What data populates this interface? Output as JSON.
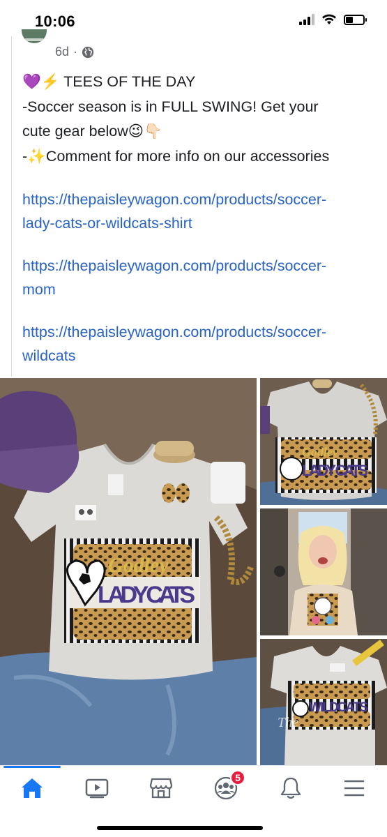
{
  "status_bar": {
    "time": "10:06",
    "battery_level": 0.4,
    "signal_bars": 3
  },
  "post": {
    "age": "6d",
    "separator": "·",
    "audience_icon": "globe-icon",
    "lines": [
      "💜⚡️ TEES OF THE DAY",
      "-Soccer season is in FULL SWING! Get your",
      "cute gear below😉👇🏻",
      "-✨Comment for more info on our accessories"
    ],
    "links": [
      {
        "line1": "https://thepaisleywagon.com/products/soccer-",
        "line2": "lady-cats-or-wildcats-shirt"
      },
      {
        "line1": "https://thepaisleywagon.com/products/soccer-",
        "line2": "mom"
      },
      {
        "line1": "https://thepaisleywagon.com/products/soccer-",
        "line2": "wildcats"
      }
    ],
    "link_color": "#2762c6"
  },
  "photos": {
    "main_shirt_text_top": "Godley",
    "main_shirt_text_bottom": "LADY CATS",
    "side_1_shirt_text_top": "Godley",
    "side_1_shirt_text_bottom": "LADY CATS",
    "side_3_shirt_text": "WILDCATS",
    "watermark": "The"
  },
  "bottom_nav": {
    "accent": "#1877f2",
    "items": [
      {
        "name": "home-icon",
        "active": true
      },
      {
        "name": "watch-icon",
        "active": false
      },
      {
        "name": "marketplace-icon",
        "active": false
      },
      {
        "name": "groups-icon",
        "active": false,
        "badge": "5"
      },
      {
        "name": "bell-icon",
        "active": false
      },
      {
        "name": "menu-icon",
        "active": false
      }
    ]
  }
}
